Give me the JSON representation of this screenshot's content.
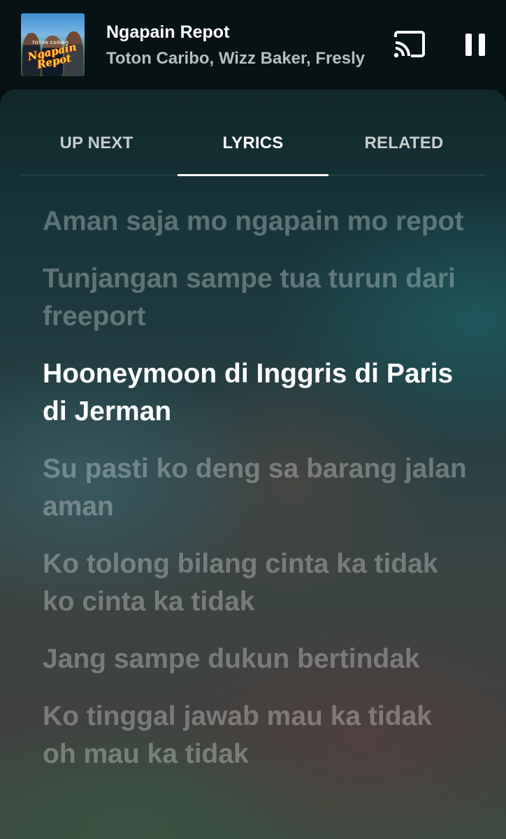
{
  "player": {
    "album_art_text": "Ngapain Repot",
    "album_art_caption": "TOTON CARIBO",
    "title": "Ngapain Repot",
    "artists": "Toton Caribo, Wizz Baker, Fresly",
    "cast_icon": "cast-icon",
    "pause_icon": "pause-icon"
  },
  "tabs": [
    {
      "label": "UP NEXT",
      "selected": false
    },
    {
      "label": "LYRICS",
      "selected": true
    },
    {
      "label": "RELATED",
      "selected": false
    }
  ],
  "lyrics": [
    {
      "text": "Aman saja mo ngapain mo repot",
      "active": false
    },
    {
      "text": "Tunjangan sampe tua turun dari freeport",
      "active": false
    },
    {
      "text": "Hooneymoon di Inggris di Paris di Jerman",
      "active": true
    },
    {
      "text": "Su pasti ko deng sa barang jalan aman",
      "active": false
    },
    {
      "text": "Ko tolong bilang cinta ka tidak ko cinta ka tidak",
      "active": false
    },
    {
      "text": "Jang sampe dukun bertindak",
      "active": false
    },
    {
      "text": "Ko tinggal jawab mau ka tidak oh mau ka tidak",
      "active": false
    }
  ],
  "colors": {
    "header_bg": "#061213",
    "active_lyric": "#ffffff",
    "inactive_lyric": "rgba(255,255,255,0.3)"
  }
}
